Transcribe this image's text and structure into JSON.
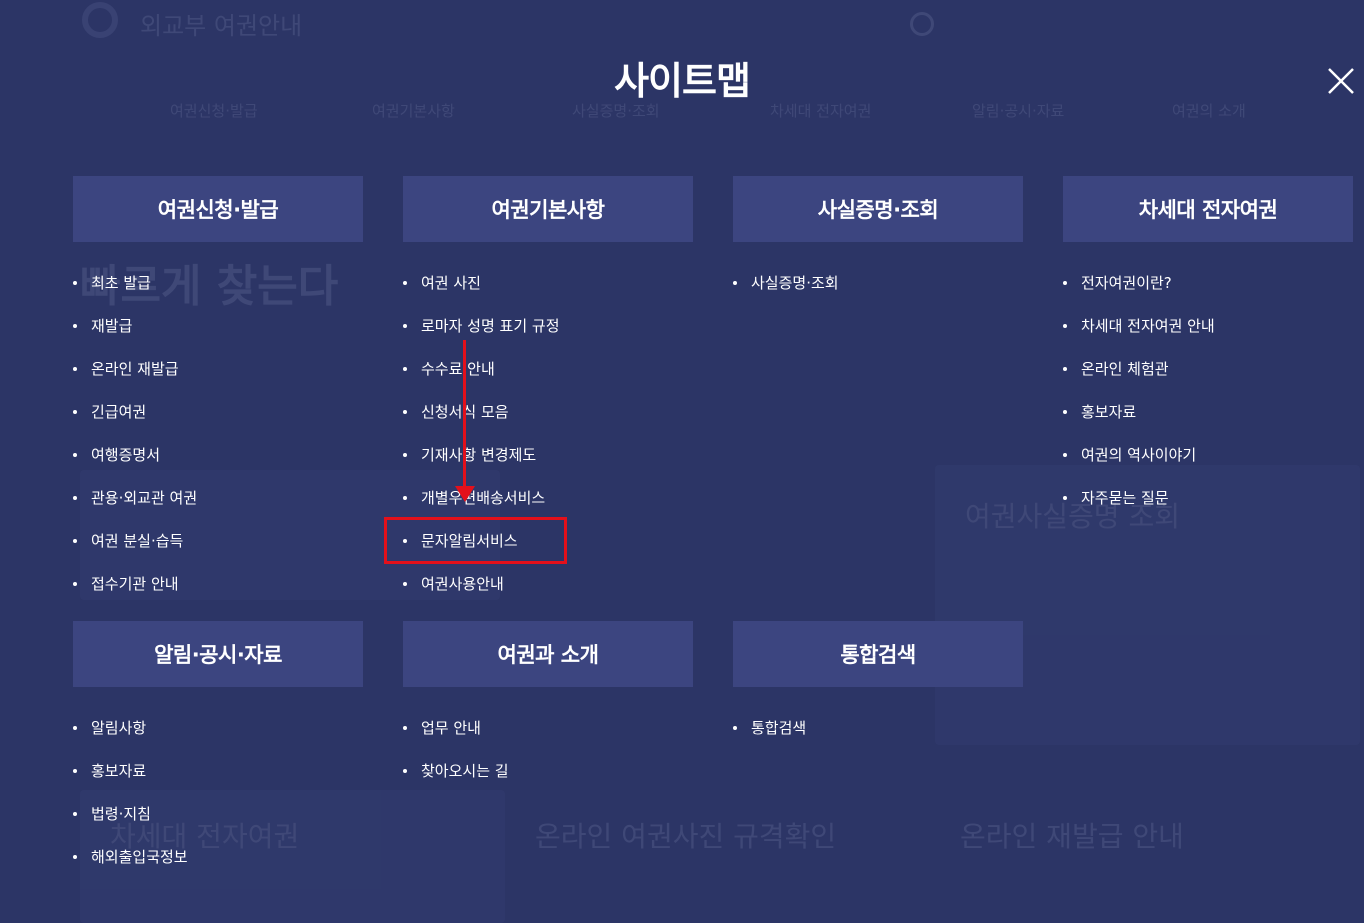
{
  "background": {
    "site_name": "외교부 여권안내",
    "nav": [
      "여권신청·발급",
      "여권기본사항",
      "사실증명·조회",
      "차세대 전자여권",
      "알림·공시·자료",
      "여권의 소개"
    ],
    "headline": "빠르게 찾는다",
    "cards": [
      "차세대 전자여권",
      "온라인 여권사진 규격확인",
      "온라인 재발급 안내",
      "여권사실증명 조회"
    ]
  },
  "sitemap": {
    "title": "사이트맵",
    "close_label": "닫기",
    "sections": [
      {
        "title": "여권신청·발급",
        "items": [
          "최초 발급",
          "재발급",
          "온라인 재발급",
          "긴급여권",
          "여행증명서",
          "관용·외교관 여권",
          "여권 분실·습득",
          "접수기관 안내"
        ]
      },
      {
        "title": "여권기본사항",
        "items": [
          "여권 사진",
          "로마자 성명 표기 규정",
          "수수료 안내",
          "신청서식 모음",
          "기재사항 변경제도",
          "개별우편배송서비스",
          "문자알림서비스",
          "여권사용안내"
        ]
      },
      {
        "title": "사실증명·조회",
        "items": [
          "사실증명·조회"
        ]
      },
      {
        "title": "차세대 전자여권",
        "items": [
          "전자여권이란?",
          "차세대 전자여권 안내",
          "온라인 체험관",
          "홍보자료",
          "여권의 역사이야기",
          "자주묻는 질문"
        ]
      },
      {
        "title": "알림·공시·자료",
        "items": [
          "알림사항",
          "홍보자료",
          "법령·지침",
          "해외출입국정보"
        ]
      },
      {
        "title": "여권과 소개",
        "items": [
          "업무 안내",
          "찾아오시는 길"
        ]
      },
      {
        "title": "통합검색",
        "items": [
          "통합검색"
        ]
      }
    ]
  },
  "annotation": {
    "color": "#e3101b",
    "highlighted_item": "문자알림서비스"
  }
}
